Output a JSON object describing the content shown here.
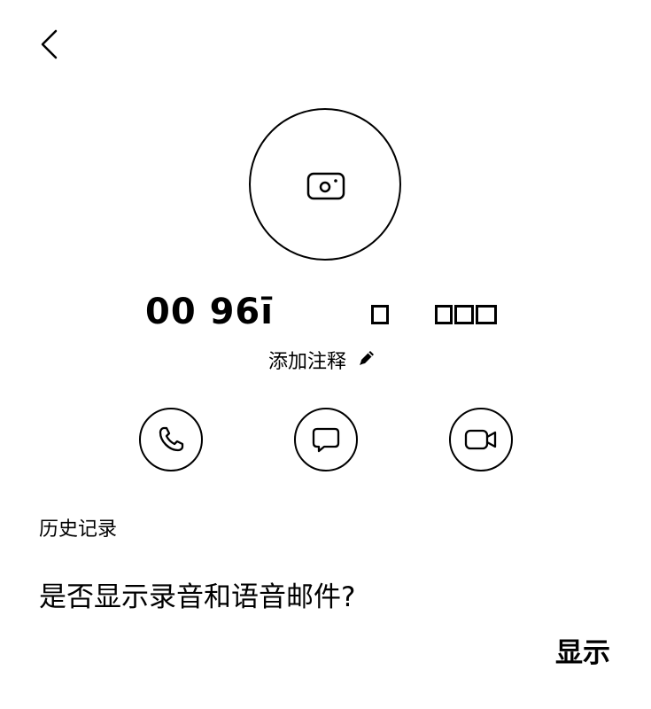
{
  "header": {
    "back_icon": "chevron-left-icon"
  },
  "contact": {
    "avatar_icon": "camera-icon",
    "number_visible": "00 96ī",
    "add_note_label": "添加注释",
    "add_note_icon": "pencil-icon"
  },
  "actions": [
    {
      "icon": "phone-icon"
    },
    {
      "icon": "message-bubble-icon"
    },
    {
      "icon": "video-camera-icon"
    }
  ],
  "history": {
    "title": "历史记录"
  },
  "voicemail_prompt": {
    "question": "是否显示录音和语音邮件?",
    "show_label": "显示"
  },
  "colors": {
    "background": "#ffffff",
    "foreground": "#000000"
  }
}
